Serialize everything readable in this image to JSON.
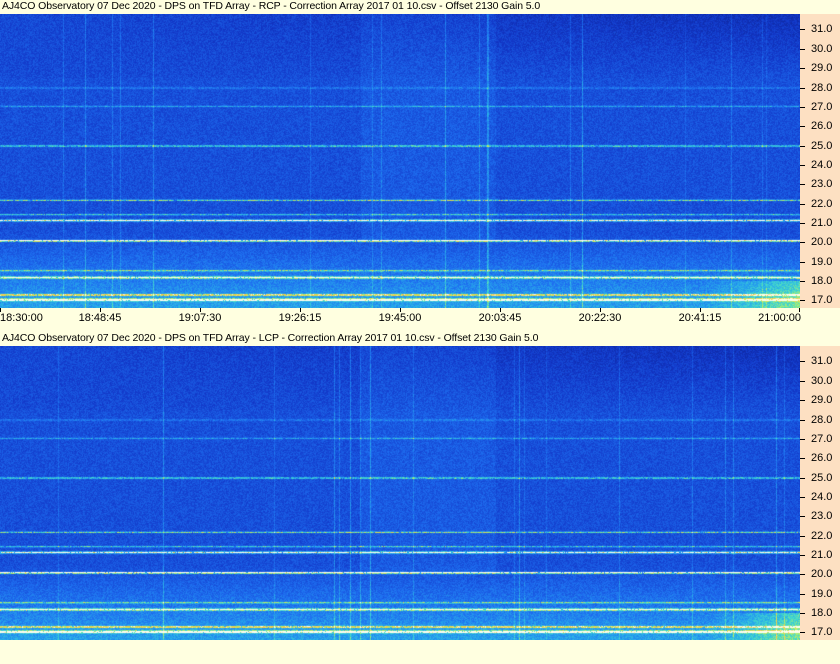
{
  "chart_data": [
    {
      "type": "heatmap",
      "title": "AJ4CO Observatory 07 Dec 2020  -  DPS on TFD Array  -  RCP  -  Correction Array 2017 01 10.csv  -  Offset 2130  Gain 5.0",
      "ylim": [
        16.6,
        31.8
      ],
      "yticks": [
        "31.0",
        "30.0",
        "29.0",
        "28.0",
        "27.0",
        "26.0",
        "25.0",
        "24.0",
        "23.0",
        "22.0",
        "21.0",
        "20.0",
        "19.0",
        "18.0",
        "17.0"
      ],
      "xticks": [
        "18:30:00",
        "18:48:45",
        "19:07:30",
        "19:26:15",
        "19:45:00",
        "20:03:45",
        "20:22:30",
        "20:41:15",
        "21:00:00"
      ],
      "grid": false
    },
    {
      "type": "heatmap",
      "title": "AJ4CO Observatory 07 Dec 2020  -  DPS on TFD Array  -  LCP  -  Correction Array 2017 01 10.csv  -  Offset 2130  Gain 5.0",
      "ylim": [
        16.6,
        31.8
      ],
      "yticks": [
        "31.0",
        "30.0",
        "29.0",
        "28.0",
        "27.0",
        "26.0",
        "25.0",
        "24.0",
        "23.0",
        "22.0",
        "21.0",
        "20.0",
        "19.0",
        "18.0",
        "17.0"
      ],
      "xticks": [],
      "grid": false
    }
  ]
}
